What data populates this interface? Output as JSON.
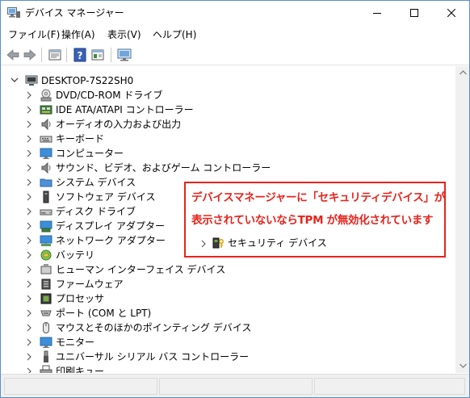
{
  "window": {
    "title": "デバイス マネージャー",
    "icon": "device-manager-icon"
  },
  "menubar": {
    "items": [
      {
        "label": "ファイル(F)",
        "icon": ""
      },
      {
        "label": "操作(A)",
        "icon": ""
      },
      {
        "label": "表示(V)",
        "icon": ""
      },
      {
        "label": "ヘルプ(H)",
        "icon": ""
      }
    ]
  },
  "toolbar": {
    "buttons": [
      "back-icon",
      "forward-icon",
      "properties-icon",
      "help-icon",
      "update-driver-icon",
      "scan-hardware-icon"
    ]
  },
  "tree": {
    "root": {
      "label": "DESKTOP-7S22SH0",
      "icon": "computer-icon",
      "expanded": true
    },
    "items": [
      {
        "label": "DVD/CD-ROM ドライブ",
        "icon": "dvd-drive-icon"
      },
      {
        "label": "IDE ATA/ATAPI コントローラー",
        "icon": "ide-controller-icon"
      },
      {
        "label": "オーディオの入力および出力",
        "icon": "speaker-icon"
      },
      {
        "label": "キーボード",
        "icon": "keyboard-icon"
      },
      {
        "label": "コンピューター",
        "icon": "monitor-icon"
      },
      {
        "label": "サウンド、ビデオ、およびゲーム コントローラー",
        "icon": "speaker-icon"
      },
      {
        "label": "システム デバイス",
        "icon": "system-folder-icon"
      },
      {
        "label": "ソフトウェア デバイス",
        "icon": "software-device-icon"
      },
      {
        "label": "ディスク ドライブ",
        "icon": "disk-drive-icon"
      },
      {
        "label": "ディスプレイ アダプター",
        "icon": "display-adapter-icon"
      },
      {
        "label": "ネットワーク アダプター",
        "icon": "network-adapter-icon"
      },
      {
        "label": "バッテリ",
        "icon": "battery-icon"
      },
      {
        "label": "ヒューマン インターフェイス デバイス",
        "icon": "hid-icon"
      },
      {
        "label": "ファームウェア",
        "icon": "firmware-icon"
      },
      {
        "label": "プロセッサ",
        "icon": "processor-icon"
      },
      {
        "label": "ポート (COM と LPT)",
        "icon": "port-icon"
      },
      {
        "label": "マウスとそのほかのポインティング デバイス",
        "icon": "mouse-icon"
      },
      {
        "label": "モニター",
        "icon": "monitor-icon"
      },
      {
        "label": "ユニバーサル シリアル バス コントローラー",
        "icon": "usb-icon"
      },
      {
        "label": "印刷キュー",
        "icon": "printer-icon"
      }
    ]
  },
  "callout": {
    "line1": "デバイスマネージャーに「セキュリティデバイス」が",
    "line2": "表示されていないならTPM が無効化されています",
    "security_item": {
      "label": "セキュリティ デバイス",
      "icon": "security-device-icon"
    },
    "border_color": "#e8231c"
  }
}
